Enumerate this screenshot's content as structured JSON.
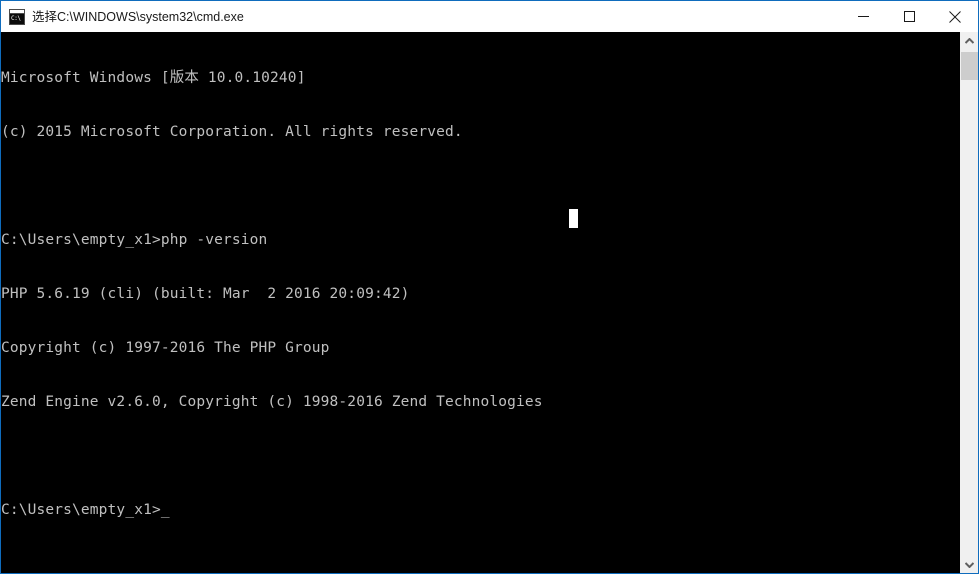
{
  "window": {
    "title": "选择C:\\WINDOWS\\system32\\cmd.exe",
    "icon_name": "cmd-exe-icon",
    "icon_text": "C:\\",
    "border_color": "#0f6cbd",
    "titlebar_background": "#ffffff",
    "console_background": "#000000",
    "console_foreground": "#c0c0c0"
  },
  "titlebar": {
    "minimize_label": "—",
    "maximize_label": "□",
    "close_label": "✕"
  },
  "console": {
    "lines": [
      "Microsoft Windows [版本 10.0.10240]",
      "(c) 2015 Microsoft Corporation. All rights reserved.",
      "",
      "C:\\Users\\empty_x1>php -version",
      "PHP 5.6.19 (cli) (built: Mar  2 2016 20:09:42)",
      "Copyright (c) 1997-2016 The PHP Group",
      "Zend Engine v2.6.0, Copyright (c) 1998-2016 Zend Technologies",
      "",
      "C:\\Users\\empty_x1>_"
    ],
    "prompt": "C:\\Users\\empty_x1>",
    "command": "php -version",
    "cursor_color": "#ffffff"
  },
  "scrollbar": {
    "up_arrow": "ⱏ",
    "down_arrow": "ⱟ",
    "thumb_color": "#cdcdcd",
    "track_color": "#f0f0f0"
  }
}
